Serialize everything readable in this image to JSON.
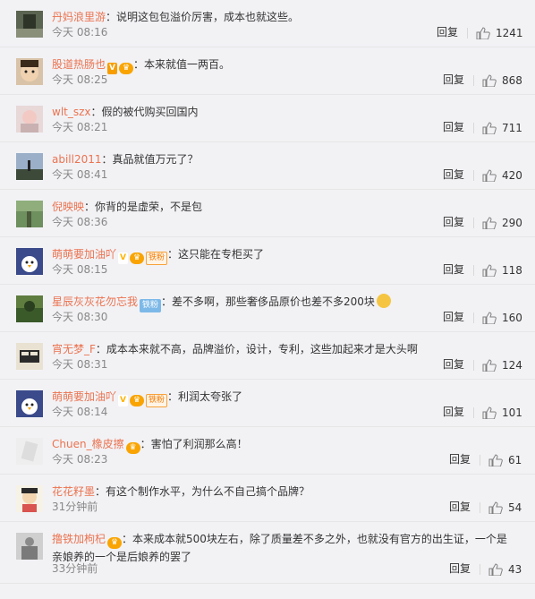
{
  "reply_label": "回复",
  "colors": {
    "name": "#eb7350",
    "text": "#333333",
    "time": "#888888",
    "bg": "#f2f2f5"
  },
  "comments": [
    {
      "name": "丹妈浪里游",
      "text": "：说明这包包溢价厉害，成本也就这些。",
      "time": "今天 08:16",
      "likes": "1241",
      "badges": []
    },
    {
      "name": "股道热肠也",
      "text": "：本来就值一两百。",
      "time": "今天 08:25",
      "likes": "868",
      "badges": [
        "V",
        "crown"
      ]
    },
    {
      "name": "wlt_szx",
      "text": "：假的被代购买回国内",
      "time": "今天 08:21",
      "likes": "711",
      "badges": []
    },
    {
      "name": "abill2011",
      "text": "：真品就值万元了？",
      "time": "今天 08:41",
      "likes": "420",
      "badges": []
    },
    {
      "name": "倪映映",
      "text": "：你背的是虚荣，不是包",
      "time": "今天 08:36",
      "likes": "290",
      "badges": []
    },
    {
      "name": "萌萌要加油吖",
      "text": "：这只能在专柜买了",
      "time": "今天 08:15",
      "likes": "118",
      "badges": [
        "v",
        "crown",
        "铁粉"
      ]
    },
    {
      "name": "星辰灰灰花勿忘我",
      "text": "：差不多啊，那些奢侈品原价也差不多200块",
      "time": "今天 08:30",
      "likes": "160",
      "badges": [
        "铁粉"
      ]
    },
    {
      "name": "宵无梦_F",
      "text": "：成本本来就不高，品牌溢价，设计，专利，这些加起来才是大头啊",
      "time": "今天 08:31",
      "likes": "124",
      "badges": []
    },
    {
      "name": "萌萌要加油吖",
      "text": "：利润太夸张了",
      "time": "今天 08:14",
      "likes": "101",
      "badges": [
        "v",
        "crown",
        "铁粉"
      ]
    },
    {
      "name": "Chuen_橡皮擦",
      "text": "：害怕了利润那么高！",
      "time": "今天 08:23",
      "likes": "61",
      "badges": [
        "crown"
      ]
    },
    {
      "name": "花花籽墨",
      "text": "：有这个制作水平，为什么不自己搞个品牌？",
      "time": "31分钟前",
      "likes": "54",
      "badges": []
    },
    {
      "name": "撸铁加枸杞",
      "text": "：本来成本就500块左右，除了质量差不多之外，也就没有官方的出生证，一个是亲娘养的一个是后娘养的罢了",
      "time": "33分钟前",
      "likes": "43",
      "badges": [
        "crown"
      ]
    }
  ]
}
